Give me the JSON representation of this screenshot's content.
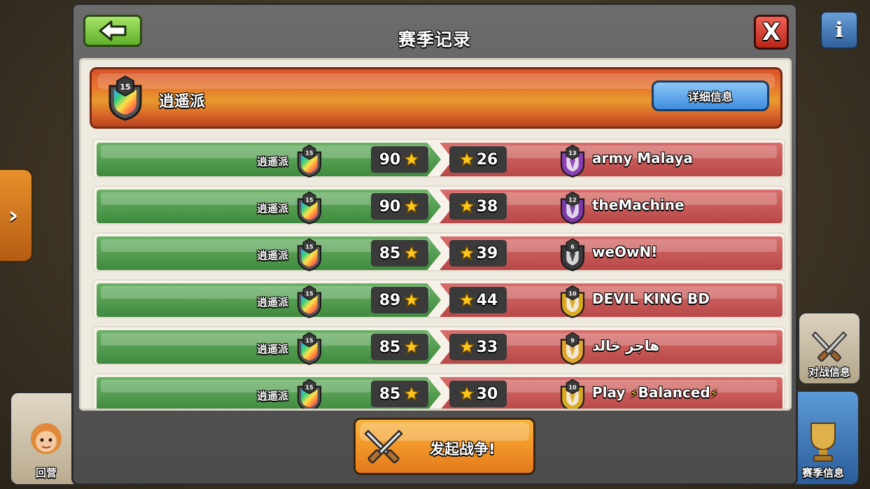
{
  "window": {
    "title": "赛季记录",
    "back_icon": "back-arrow-icon",
    "close_label": "X"
  },
  "background": {
    "home_label": "回营",
    "battle_info_label": "对战信息",
    "season_info_label": "赛季信息",
    "info_label": "i",
    "side_arrow_label": "›"
  },
  "clan": {
    "name": "逍遥派",
    "level": "15",
    "details_button": "详细信息"
  },
  "colors": {
    "our_side": "#4f9a4c",
    "enemy_side": "#c55955",
    "star": "#ffc61a"
  },
  "wars": [
    {
      "our_name": "逍遥派",
      "our_level": "15",
      "our_stars": "90",
      "opp_stars": "26",
      "opp_name": "army Malaya",
      "opp_level": "13",
      "opp_badge_color": "#8a3fb5"
    },
    {
      "our_name": "逍遥派",
      "our_level": "15",
      "our_stars": "90",
      "opp_stars": "38",
      "opp_name": "theMachine",
      "opp_level": "12",
      "opp_badge_color": "#7b3aa8"
    },
    {
      "our_name": "逍遥派",
      "our_level": "15",
      "our_stars": "85",
      "opp_stars": "39",
      "opp_name": "weOwN!",
      "opp_level": "6",
      "opp_badge_color": "#3a3a3a"
    },
    {
      "our_name": "逍遥派",
      "our_level": "15",
      "our_stars": "89",
      "opp_stars": "44",
      "opp_name": "DEVIL KING BD",
      "opp_level": "10",
      "opp_badge_color": "#d9a91f"
    },
    {
      "our_name": "逍遥派",
      "our_level": "15",
      "our_stars": "85",
      "opp_stars": "33",
      "opp_name": "هاجر خالد",
      "opp_level": "9",
      "opp_badge_color": "#e0a52a"
    },
    {
      "our_name": "逍遥派",
      "our_level": "15",
      "our_stars": "85",
      "opp_stars": "30",
      "opp_name_parts": [
        "Play ",
        "⚡",
        "Balanced",
        "⚡"
      ],
      "opp_level": "10",
      "opp_badge_color": "#d9a91f"
    }
  ],
  "start_war_button": "发起战争!"
}
